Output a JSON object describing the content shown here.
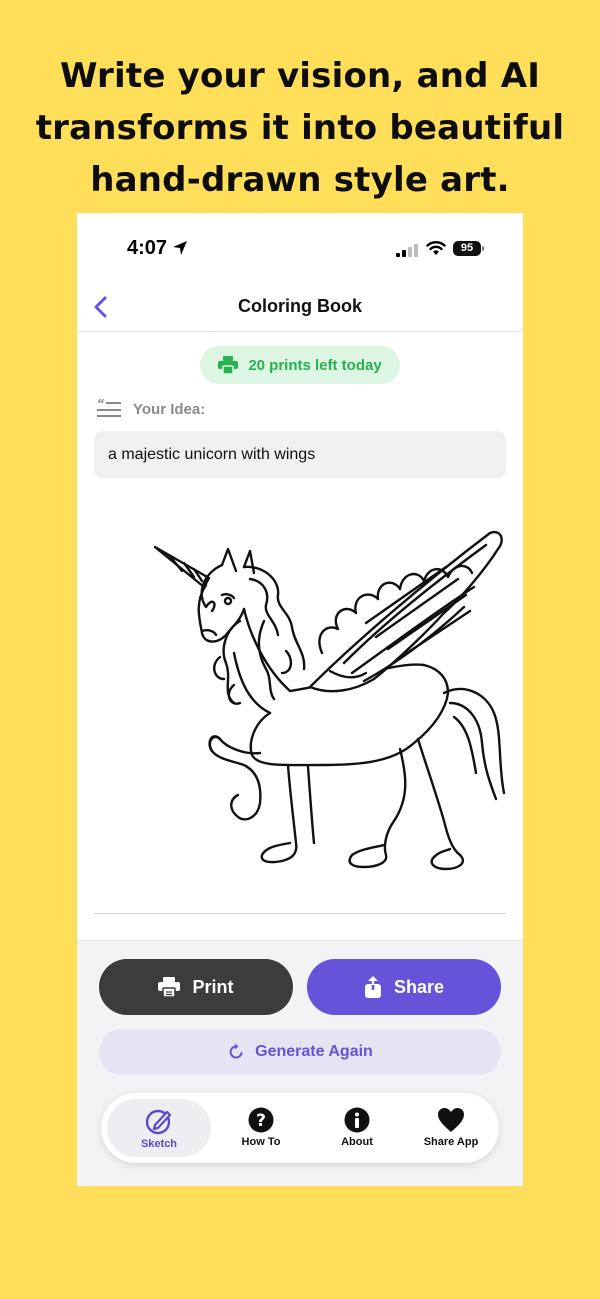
{
  "headline": {
    "line1": "Write your vision, and AI",
    "line2": "transforms it into beautiful",
    "line3": "hand-drawn style art."
  },
  "status_bar": {
    "time": "4:07",
    "battery": "95"
  },
  "nav": {
    "title": "Coloring Book",
    "back_icon": "chevron-left-icon"
  },
  "prints_badge": {
    "text": "20 prints left today",
    "icon": "printer-icon",
    "color": "#28B14F"
  },
  "idea": {
    "label": "Your Idea:",
    "value": "a majestic unicorn with wings",
    "icon": "quote-lines-icon"
  },
  "artwork": {
    "subject": "winged-unicorn-line-art"
  },
  "actions": {
    "print_label": "Print",
    "share_label": "Share",
    "regenerate_label": "Generate Again"
  },
  "tabs": [
    {
      "label": "Sketch",
      "icon": "pencil-circle-icon",
      "active": true
    },
    {
      "label": "How To",
      "icon": "question-circle-icon",
      "active": false
    },
    {
      "label": "About",
      "icon": "info-circle-icon",
      "active": false
    },
    {
      "label": "Share App",
      "icon": "heart-icon",
      "active": false
    }
  ],
  "colors": {
    "background": "#FFDE59",
    "accent": "#6553DA",
    "print_button": "#3C3C3C",
    "badge_bg": "#DDF6E3"
  }
}
